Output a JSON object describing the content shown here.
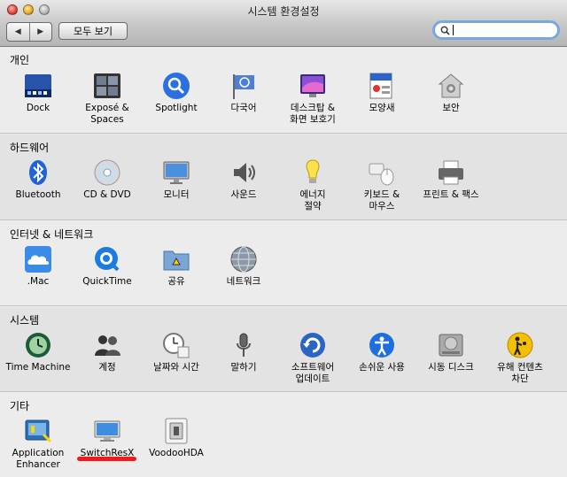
{
  "window": {
    "title": "시스템 환경설정"
  },
  "toolbar": {
    "back": "◀",
    "forward": "▶",
    "show_all": "모두 보기",
    "search_value": ""
  },
  "sections": [
    {
      "title": "개인",
      "items": [
        "Dock",
        "Exposé &\nSpaces",
        "Spotlight",
        "다국어",
        "데스크탑 &\n화면 보호기",
        "모양새",
        "보안"
      ]
    },
    {
      "title": "하드웨어",
      "items": [
        "Bluetooth",
        "CD & DVD",
        "모니터",
        "사운드",
        "에너지\n절약",
        "키보드 &\n마우스",
        "프린트 & 팩스"
      ]
    },
    {
      "title": "인터넷 & 네트워크",
      "items": [
        ".Mac",
        "QuickTime",
        "공유",
        "네트워크"
      ]
    },
    {
      "title": "시스템",
      "items": [
        "Time Machine",
        "계정",
        "날짜와 시간",
        "말하기",
        "소프트웨어\n업데이트",
        "손쉬운 사용",
        "시동 디스크",
        "유해 컨텐츠\n차단"
      ]
    },
    {
      "title": "기타",
      "items": [
        "Application\nEnhancer",
        "SwitchResX",
        "VoodooHDA"
      ]
    }
  ],
  "annotation": {
    "color": "#f21b1b"
  }
}
